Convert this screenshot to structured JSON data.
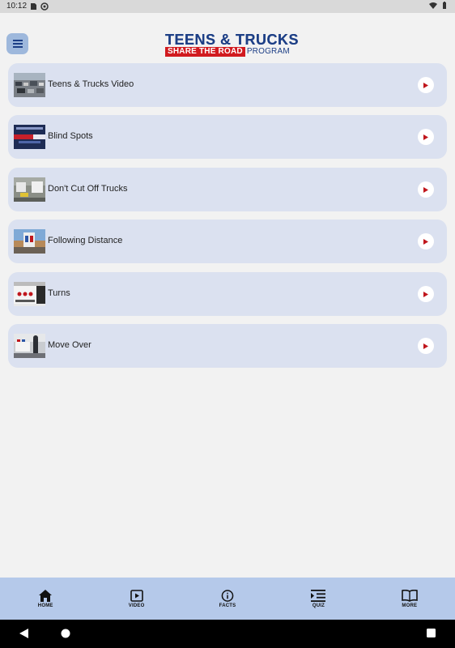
{
  "status_bar": {
    "time": "10:12"
  },
  "header": {
    "logo_title": "TEENS & TRUCKS",
    "logo_red": "SHARE THE ROAD",
    "logo_program": "PROGRAM"
  },
  "videos": [
    {
      "label": "Teens & Trucks Video",
      "icon": "play-icon"
    },
    {
      "label": "Blind Spots",
      "icon": "play-icon"
    },
    {
      "label": "Don't Cut Off Trucks",
      "icon": "play-icon"
    },
    {
      "label": "Following Distance",
      "icon": "play-icon"
    },
    {
      "label": "Turns",
      "icon": "play-icon"
    },
    {
      "label": "Move Over",
      "icon": "play-icon"
    }
  ],
  "bottom_nav": [
    {
      "label": "HOME",
      "icon": "home-icon"
    },
    {
      "label": "VIDEO",
      "icon": "video-icon"
    },
    {
      "label": "FACTS",
      "icon": "info-icon"
    },
    {
      "label": "QUIZ",
      "icon": "quiz-icon"
    },
    {
      "label": "MORE",
      "icon": "book-icon"
    }
  ],
  "colors": {
    "card_bg": "#dbe1f0",
    "nav_bg": "#b5c9ea",
    "menu_btn": "#9eb8dc",
    "brand_blue": "#1d3f86",
    "brand_red": "#d11a1f",
    "play_red": "#c0161c"
  }
}
